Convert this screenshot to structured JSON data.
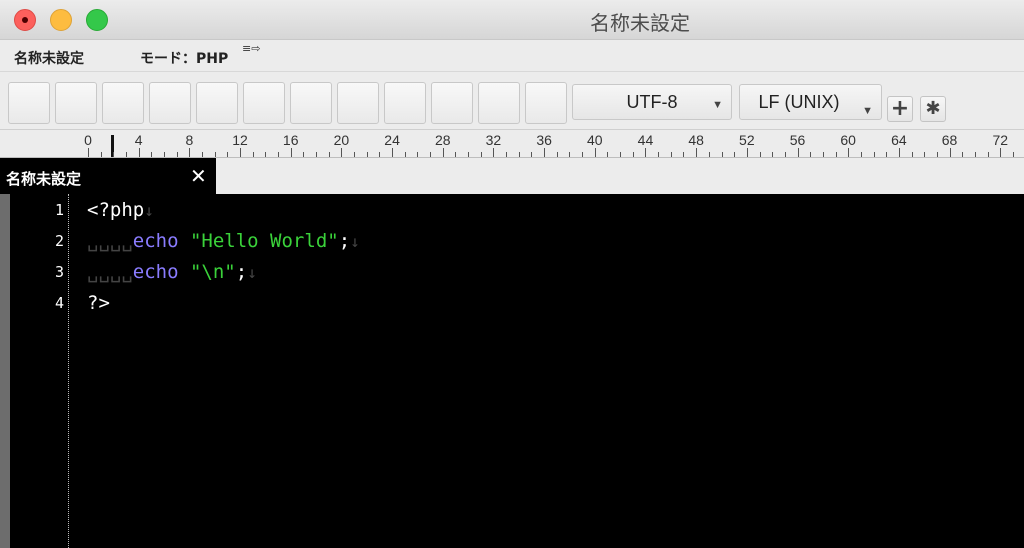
{
  "window": {
    "title": "名称未設定"
  },
  "infobar": {
    "document_name": "名称未設定",
    "mode": "モード：PHP",
    "wrap_icon": "≡⇨"
  },
  "toolbar": {
    "encoding": "UTF-8",
    "line_ending": "LF (UNIX)",
    "add_icon": "plus-icon",
    "settings_icon": "gear-icon"
  },
  "ruler": {
    "labels": [
      "0",
      "4",
      "8",
      "12",
      "16",
      "20",
      "24",
      "28",
      "32",
      "36",
      "40",
      "44",
      "48",
      "52",
      "56",
      "60",
      "64",
      "68",
      "72"
    ]
  },
  "tab": {
    "label": "名称未設定",
    "close": "✕"
  },
  "editor": {
    "line_numbers": [
      "1",
      "2",
      "3",
      "4"
    ],
    "lines": [
      {
        "plain": "<?php"
      },
      {
        "indent": "␣␣␣␣",
        "keyword": "echo",
        "string": "\"Hello World\"",
        "tail": ";"
      },
      {
        "indent": "␣␣␣␣",
        "keyword": "echo",
        "string": "\"\\n\"",
        "tail": ";"
      },
      {
        "plain": "?>"
      }
    ],
    "eol_marker": "↓"
  },
  "colors": {
    "keyword": "#8a7cff",
    "string": "#3ad23a",
    "background": "#000000"
  }
}
